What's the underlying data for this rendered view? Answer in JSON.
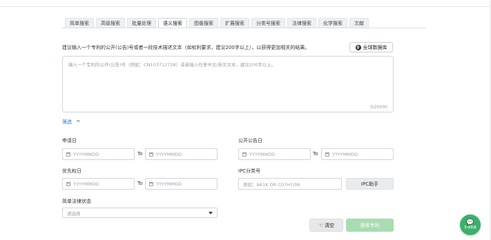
{
  "tabs": [
    {
      "label": "简单搜索",
      "active": false
    },
    {
      "label": "高级搜索",
      "active": false
    },
    {
      "label": "批量处理",
      "active": false
    },
    {
      "label": "语义搜索",
      "active": true
    },
    {
      "label": "图像搜索",
      "active": false
    },
    {
      "label": "扩展搜索",
      "active": false
    },
    {
      "label": "分类号搜索",
      "active": false
    },
    {
      "label": "法律搜索",
      "active": false
    },
    {
      "label": "化学搜索",
      "active": false
    },
    {
      "label": "文献",
      "active": false
    }
  ],
  "hint": "建议输入一个专利的公开(公告)号或者一段技术描述文本（如权利要求，建议200字以上），以获得更加相关的结果。",
  "global_db_label": "全球数据库",
  "textarea": {
    "placeholder": "输入一个专利的公开(公告)号（例如：CN103712728）或者输入任意中文/英文文本，建议200字以上。",
    "counter": "0/20000"
  },
  "filter_label": "筛选",
  "filter_chevron": "^",
  "fields": {
    "apply_date": {
      "label": "申请日",
      "from_placeholder": "YYYYMMDD",
      "to_placeholder": "YYYYMMDD",
      "to_text": "To"
    },
    "pub_date": {
      "label": "公开公告日",
      "from_placeholder": "YYYYMMDD",
      "to_placeholder": "YYYYMMDD",
      "to_text": "To"
    },
    "priority_date": {
      "label": "优先权日",
      "from_placeholder": "YYYYMMDD",
      "to_placeholder": "YYYYMMDD",
      "to_text": "To"
    },
    "ipc": {
      "label": "IPC分类号",
      "placeholder": "例如：A61K OR C07H7/06",
      "helper_label": "IPC助手"
    },
    "legal_status": {
      "label": "简单法律状态",
      "placeholder": "请选择"
    }
  },
  "buttons": {
    "clear": "清空",
    "search": "搜索专利"
  },
  "service": {
    "label": "在线客服"
  },
  "colors": {
    "accent": "#2a72c8",
    "search_button": "#a8dcb1",
    "service": "#3bb06b"
  }
}
